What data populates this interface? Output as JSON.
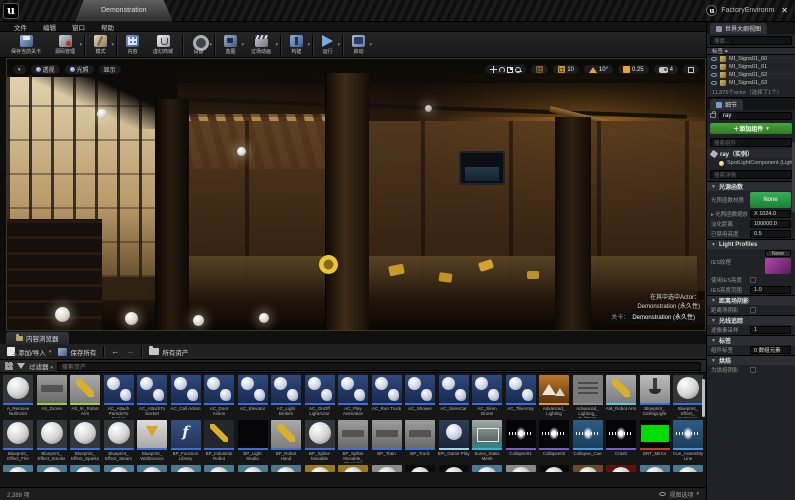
{
  "window": {
    "logo_text": "u",
    "doc_tab": "Demonstration",
    "project_title": "FactoryEnvironm",
    "close_glyph": "✕"
  },
  "menubar": [
    "文件",
    "编辑",
    "窗口",
    "帮助"
  ],
  "toolbar": [
    {
      "label": "保存当前关卡",
      "icon": "save"
    },
    {
      "label": "源码管理",
      "icon": "source",
      "caret": true,
      "sep_after": true
    },
    {
      "label": "模式",
      "icon": "modes",
      "caret": true,
      "sep_after": true
    },
    {
      "label": "内容",
      "icon": "content"
    },
    {
      "label": "虚幻商城",
      "icon": "marketplace",
      "sep_after": true
    },
    {
      "label": "设置",
      "icon": "settings",
      "caret": true,
      "sep_after": true
    },
    {
      "label": "蓝图",
      "icon": "blueprints",
      "caret": true
    },
    {
      "label": "过场动画",
      "icon": "cinematics",
      "caret": true,
      "sep_after": true
    },
    {
      "label": "构建",
      "icon": "build",
      "caret": true,
      "sep_after": true
    },
    {
      "label": "运行",
      "icon": "play",
      "caret": true,
      "sep_after": true
    },
    {
      "label": "启动",
      "icon": "launch",
      "caret": true
    }
  ],
  "viewport": {
    "menus": [
      "透视",
      "光照",
      "显示"
    ],
    "snap": {
      "grid_value": "10",
      "angle_value": "10°",
      "scale_value": "0.25",
      "camera_value": "4"
    },
    "overlay": {
      "line1": "在其中选中Actor：",
      "line2": "Demonstration (永久性)",
      "level_label": "关卡：",
      "level_value": "Demonstration (永久性)"
    }
  },
  "outliner": {
    "tab": "世界大纲视图",
    "search_placeholder": "搜索...",
    "column": "标签",
    "sort_glyph": "▴",
    "rows": [
      "MI_Signs01_60",
      "MI_Signs01_61",
      "MI_Signs01_62",
      "MI_Signs01_63"
    ],
    "footer": "11,876个actor（选择了1个）"
  },
  "details": {
    "tab": "细节",
    "name_value": "ray",
    "add_component": "＋添加组件",
    "search_components": "搜索组件",
    "instance_label": "ray（实例）",
    "component_label": "SpotLightComponent (Light...",
    "search_details": "搜索详情",
    "sections": [
      {
        "title": "光源函数",
        "rows": [
          {
            "label": "光照函数材质",
            "control": "green_none",
            "value": "None"
          },
          {
            "label": "光照函数缩放",
            "value": "X 1024.0",
            "expand": true
          },
          {
            "label": "淡化距离",
            "value": "100000.0"
          },
          {
            "label": "已禁用亮度",
            "value": "0.5"
          }
        ]
      },
      {
        "title": "Light Profiles",
        "rows": [
          {
            "label": "IES纹理",
            "control": "ies_none",
            "value": "None"
          },
          {
            "label": "使用IES亮度",
            "control": "checkbox"
          },
          {
            "label": "IES亮度范围",
            "value": "1.0"
          }
        ]
      },
      {
        "title": "距离场阴影",
        "rows": [
          {
            "label": "距离场阴影",
            "control": "checkbox"
          }
        ]
      },
      {
        "title": "光线追踪",
        "rows": [
          {
            "label": "逐像素采样",
            "value": "1"
          }
        ]
      },
      {
        "title": "标签",
        "rows": [
          {
            "label": "组件标签",
            "value": "0 数组元素"
          }
        ]
      },
      {
        "title": "烘焙",
        "rows": [
          {
            "label": "为烘焙阴影",
            "control": "checkbox"
          }
        ]
      }
    ]
  },
  "content_browser": {
    "tab": "内容浏览器",
    "add_import": "添加/导入",
    "save_all": "保存所有",
    "back_glyph": "←",
    "forward_glyph": "→",
    "all_assets": "所有资产",
    "filters": "过滤器",
    "search_placeholder": "搜索资产",
    "status_count": "2,388 项",
    "view_options": "视图选项",
    "rows": [
      [
        {
          "name": "A_Remove NullActor",
          "type": "sphere",
          "bar": "#3a6fe0"
        },
        {
          "name": "AS_Drone",
          "type": "photo",
          "bar": "#a8c838"
        },
        {
          "name": "AS_IK_Robot Arm",
          "type": "robot",
          "bar": "#a8c838"
        },
        {
          "name": "AC_Attach ParticleTo Socket",
          "type": "bp",
          "bar": "#3a6fe0"
        },
        {
          "name": "AC_AttachTo Socket",
          "type": "bp",
          "bar": "#3a6fe0"
        },
        {
          "name": "AC_Call Action",
          "type": "bp",
          "bar": "#3a6fe0"
        },
        {
          "name": "AC_Door Action",
          "type": "bp",
          "bar": "#3a6fe0"
        },
        {
          "name": "AC_Elevator",
          "type": "bp",
          "bar": "#3a6fe0"
        },
        {
          "name": "AC_Light Broken",
          "type": "bp",
          "bar": "#3a6fe0"
        },
        {
          "name": "AC_OnOff LightActor",
          "type": "bp",
          "bar": "#3a6fe0"
        },
        {
          "name": "AC_Play Animation",
          "type": "bp",
          "bar": "#3a6fe0"
        },
        {
          "name": "AC_Run Truck",
          "type": "bp",
          "bar": "#3a6fe0"
        },
        {
          "name": "AC_Shower",
          "type": "bp",
          "bar": "#3a6fe0"
        },
        {
          "name": "AC_SirenCar",
          "type": "bp",
          "bar": "#3a6fe0"
        },
        {
          "name": "AC_Siren Drone",
          "type": "bp",
          "bar": "#3a6fe0"
        },
        {
          "name": "AC_TileArray",
          "type": "bp",
          "bar": "#3a6fe0"
        },
        {
          "name": "Advanced_ Lighting",
          "type": "map",
          "bar": "#e8953a"
        },
        {
          "name": "Advanced_ Lighting_ BuiltData",
          "type": "built",
          "bar": "#8a8a8a"
        },
        {
          "name": "AM_Robot Arm",
          "type": "robot",
          "bar": "#58c8d8"
        },
        {
          "name": "Blueprint_ CeilingLight",
          "type": "lamp",
          "bar": "#3a6fe0"
        },
        {
          "name": "Blueprint_ Effect_ Explosion",
          "type": "sphere",
          "bar": "#3a6fe0"
        }
      ],
      [
        {
          "name": "Blueprint_ Effect_Fire",
          "type": "sphere",
          "bar": "#3a6fe0"
        },
        {
          "name": "Blueprint_ Effect_Smoke",
          "type": "sphere",
          "bar": "#3a6fe0"
        },
        {
          "name": "Blueprint_ Effect_Sparks",
          "type": "sphere",
          "bar": "#3a6fe0"
        },
        {
          "name": "Blueprint_ Effect_Steam",
          "type": "sphere",
          "bar": "#3a6fe0"
        },
        {
          "name": "Blueprint_ WallSconce",
          "type": "sconce",
          "bar": "#3a6fe0"
        },
        {
          "name": "BP_Function Library",
          "type": "funclib",
          "bar": "#3a6fe0"
        },
        {
          "name": "BP_Industrial Robot",
          "type": "robotdark",
          "bar": "#3a6fe0"
        },
        {
          "name": "BP_Light Studio",
          "type": "black",
          "bar": "#3a6fe0"
        },
        {
          "name": "BP_Robot Hand",
          "type": "robot",
          "bar": "#3a6fe0"
        },
        {
          "name": "BP_Spline Movable",
          "type": "sphere",
          "bar": "#3a6fe0"
        },
        {
          "name": "BP_Spline Movable_ Blueprint",
          "type": "photo",
          "bar": "#3a6fe0"
        },
        {
          "name": "BP_Train",
          "type": "photo",
          "bar": "#3a6fe0"
        },
        {
          "name": "BP_Truck",
          "type": "photo",
          "bar": "#3a6fe0"
        },
        {
          "name": "BPI_Game Play",
          "type": "interface",
          "bar": "#9ad8e8"
        },
        {
          "name": "Sumo_Static Mesh",
          "type": "mesh",
          "bar": "#28b8d8"
        },
        {
          "name": "Collapse01",
          "type": "sound",
          "bar": "#7a5ad8"
        },
        {
          "name": "Collapse02",
          "type": "sound",
          "bar": "#7a5ad8"
        },
        {
          "name": "Collapse_Cue",
          "type": "cue",
          "bar": "#3a9ae8"
        },
        {
          "name": "Crash",
          "type": "sound",
          "bar": "#7a5ad8"
        },
        {
          "name": "DRT_Mirror",
          "type": "rt",
          "bar": "#c83a3a"
        },
        {
          "name": "Cue_Assembly Line",
          "type": "cue",
          "bar": "#3a9ae8"
        }
      ]
    ],
    "row3_colors": [
      "#4a7a92",
      "#4a7a92",
      "#4a7a92",
      "#4a7a92",
      "#4a7a92",
      "#4a7a92",
      "#4a7a92",
      "#4a7a92",
      "#4a7a92",
      "#9a7a1e",
      "#9a7a1e",
      "#8a8a8a",
      "#0a0a0a",
      "#0a0a0a",
      "#4a7a92",
      "#8a8a8a",
      "#0a0a0a",
      "#6a4a28",
      "#5a1408",
      "#4a7a92",
      "#4a7a92"
    ]
  }
}
